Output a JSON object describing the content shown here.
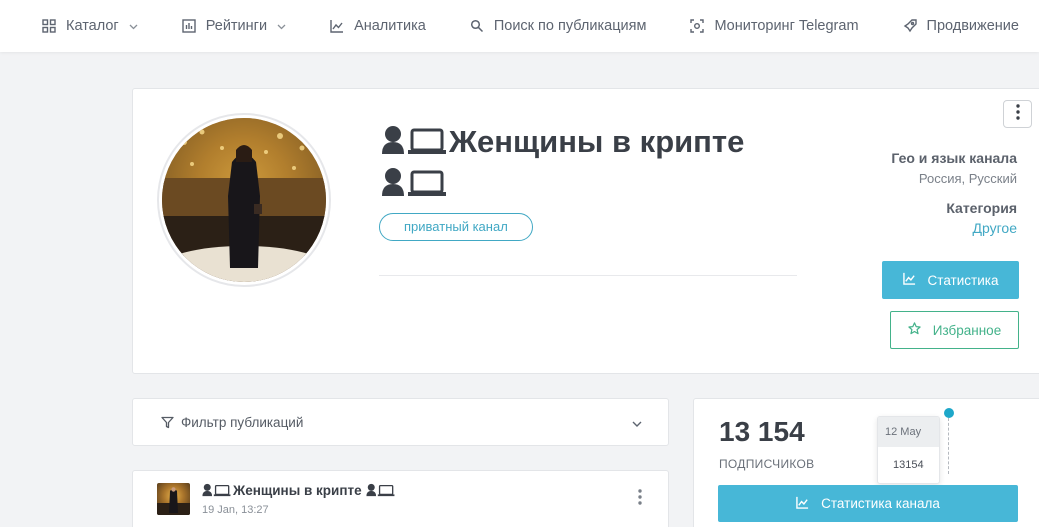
{
  "nav": {
    "items": [
      {
        "label": "Каталог",
        "icon": "grid-icon",
        "dropdown": true
      },
      {
        "label": "Рейтинги",
        "icon": "bar-chart-icon",
        "dropdown": true
      },
      {
        "label": "Аналитика",
        "icon": "line-chart-icon",
        "dropdown": false
      },
      {
        "label": "Поиск по публикациям",
        "icon": "search-icon",
        "dropdown": false
      },
      {
        "label": "Мониторинг Telegram",
        "icon": "scan-icon",
        "dropdown": false
      },
      {
        "label": "Продвижение",
        "icon": "rocket-icon",
        "dropdown": false
      }
    ]
  },
  "channel": {
    "title": "Женщины в крипте",
    "title_emoji": "woman-laptop-emoji",
    "badge": "приватный канал",
    "geo_label": "Гео и язык канала",
    "geo_value": "Россия, Русский",
    "category_label": "Категория",
    "category_value": "Другое",
    "stats_button": "Статистика",
    "favorite_button": "Избранное"
  },
  "filter": {
    "label": "Фильтр публикаций"
  },
  "post": {
    "title": "Женщины в крипте",
    "date": "19 Jan, 13:27"
  },
  "subscribers": {
    "count": "13 154",
    "label": "ПОДПИСЧИКОВ",
    "tooltip_date": "12 May",
    "tooltip_value": "13154",
    "button": "Статистика канала"
  },
  "colors": {
    "accent": "#47b7d7",
    "link": "#41a8c4",
    "favorite": "#43b28a",
    "text_dark": "#3a3f47"
  }
}
